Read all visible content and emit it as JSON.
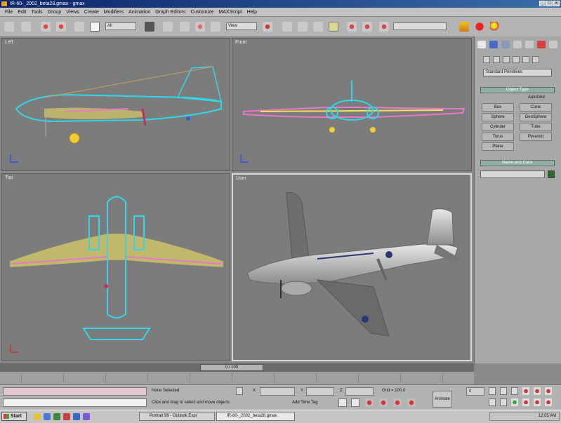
{
  "app": {
    "title": "IR-60-_2002_beta28.gmax - gmax",
    "window_buttons": [
      "_",
      "□",
      "✕"
    ]
  },
  "menu": [
    "File",
    "Edit",
    "Tools",
    "Group",
    "Views",
    "Create",
    "Modifiers",
    "Animation",
    "Graph Editors",
    "Customize",
    "MAXScript",
    "Help"
  ],
  "toolbar": {
    "selection_filter": "All",
    "reference_coord": "View",
    "named_selection": ""
  },
  "viewports": {
    "left": "Left",
    "front": "Front",
    "top": "Top",
    "user": "User"
  },
  "command_panel": {
    "dropdown": "Standard Primitives",
    "object_type_title": "Object Type",
    "autogrid": "AutoGrid",
    "buttons": [
      "Box",
      "Cone",
      "Sphere",
      "GeoSphere",
      "Cylinder",
      "Tube",
      "Torus",
      "Pyramid",
      "Plane"
    ],
    "name_color_title": "Name and Color",
    "name_value": ""
  },
  "time": {
    "slider": "0 / 100"
  },
  "status": {
    "selection": "None Selected",
    "prompt": "Click and drag to select and move objects",
    "add_time_tag": "Add Time Tag",
    "x_label": "X",
    "y_label": "Y",
    "z_label": "Z",
    "grid": "Grid = 100.0",
    "frame": "0",
    "animate": "Animate"
  },
  "taskbar": {
    "start": "Start",
    "tasks": [
      "Portrait 99 - Outlook Expr",
      "IR-60-_2002_beta28.gmax"
    ],
    "clock": "12:05 AM"
  },
  "colors": {
    "viewport_bg": "#7c7c7c",
    "wire_cyan": "#2fd8e8",
    "wire_yellow": "#f0e060",
    "wire_pink": "#e878c8",
    "active_border": "#d8d8d8"
  }
}
